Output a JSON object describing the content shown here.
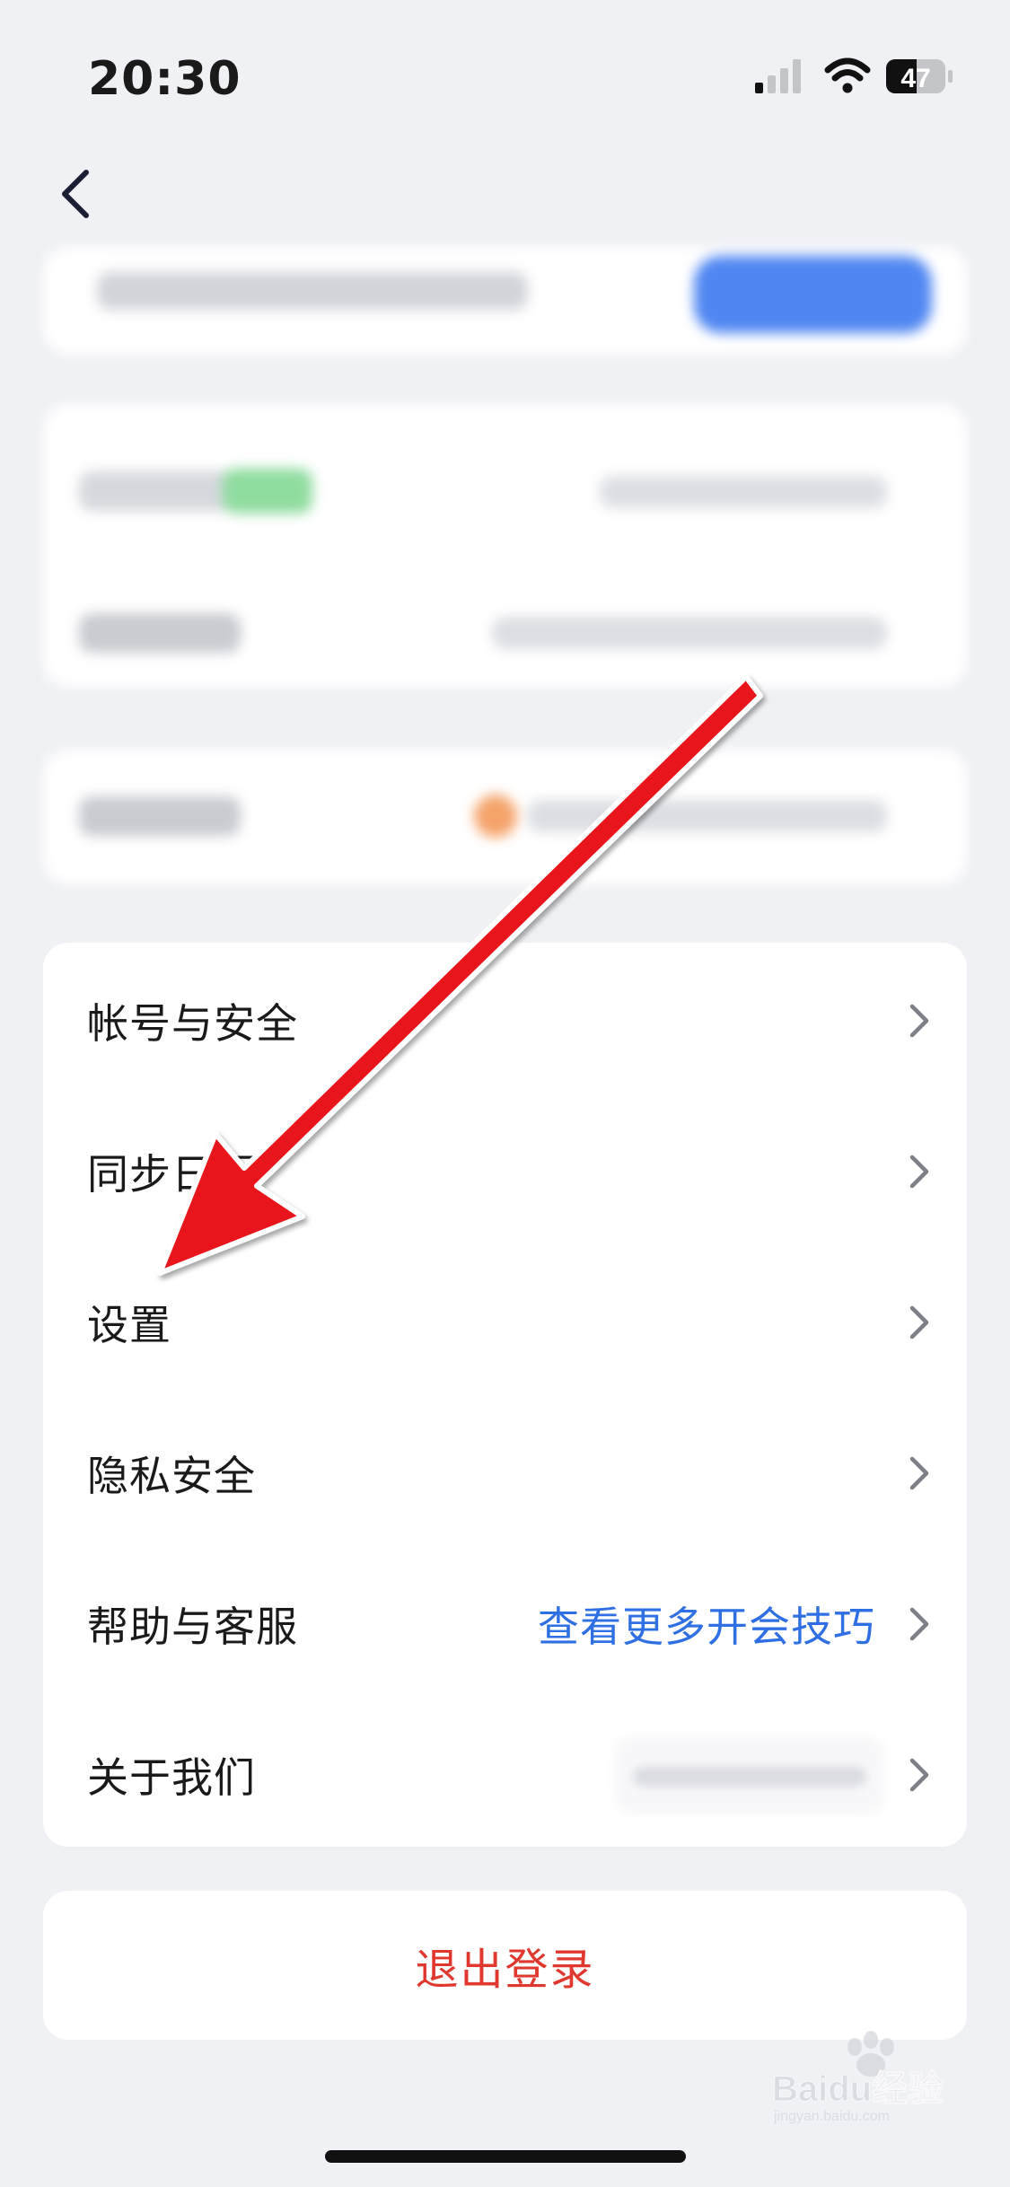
{
  "status_bar": {
    "time": "20:30",
    "battery_level": "47",
    "signal_bars_active": 1,
    "icons": [
      "cellular-signal-icon",
      "wifi-icon",
      "battery-icon"
    ]
  },
  "nav": {
    "back_icon": "chevron-left-icon"
  },
  "menu": {
    "items": [
      {
        "label": "帐号与安全",
        "value": ""
      },
      {
        "label": "同步日历",
        "value": ""
      },
      {
        "label": "设置",
        "value": ""
      },
      {
        "label": "隐私安全",
        "value": ""
      },
      {
        "label": "帮助与客服",
        "value": "查看更多开会技巧"
      },
      {
        "label": "关于我们",
        "value": ""
      }
    ],
    "chevron_icon": "chevron-right-icon"
  },
  "logout": {
    "label": "退出登录"
  },
  "annotation": {
    "arrow_color": "#e8151a"
  },
  "watermark": {
    "text": "Baidu经验",
    "url_text": "jingyan.baidu.com"
  },
  "colors": {
    "background": "#f0f1f5",
    "link_blue": "#2f6fe4",
    "logout_red": "#e0382f"
  }
}
